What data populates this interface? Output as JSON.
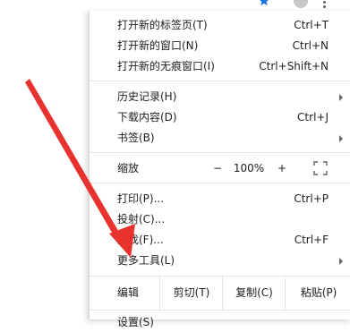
{
  "menu": {
    "new_tab": {
      "label": "打开新的标签页(T)",
      "shortcut": "Ctrl+T"
    },
    "new_window": {
      "label": "打开新的窗口(N)",
      "shortcut": "Ctrl+N"
    },
    "incognito": {
      "label": "打开新的无痕窗口(I)",
      "shortcut": "Ctrl+Shift+N"
    },
    "history": {
      "label": "历史记录(H)"
    },
    "downloads": {
      "label": "下载内容(D)",
      "shortcut": "Ctrl+J"
    },
    "bookmarks": {
      "label": "书签(B)"
    },
    "zoom": {
      "label": "缩放",
      "minus": "−",
      "level": "100%",
      "plus": "+"
    },
    "print": {
      "label": "打印(P)...",
      "shortcut": "Ctrl+P"
    },
    "cast": {
      "label": "投射(C)..."
    },
    "find": {
      "label": "查找(F)...",
      "shortcut": "Ctrl+F"
    },
    "more_tools": {
      "label": "更多工具(L)"
    },
    "edit": {
      "label": "编辑",
      "cut": "剪切(T)",
      "copy": "复制(C)",
      "paste": "粘贴(P)"
    },
    "settings": {
      "label": "设置(S)"
    }
  },
  "icons": {
    "star": "star-icon",
    "fullscreen": "fullscreen-icon",
    "more": "more-vert-icon",
    "submenu": "chevron-right-icon"
  },
  "colors": {
    "accent": "#1a73e8",
    "annotation_arrow": "#e8322d"
  }
}
